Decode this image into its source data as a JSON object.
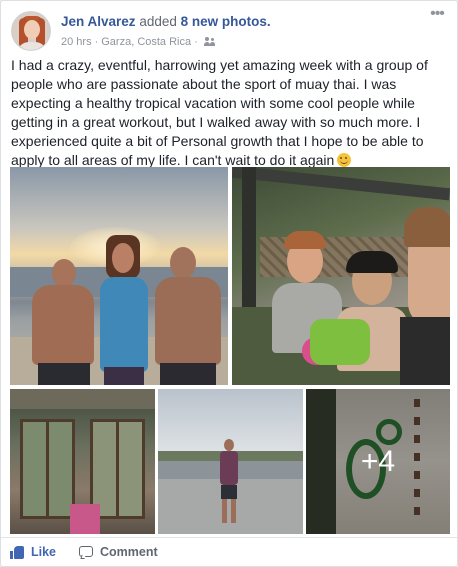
{
  "post": {
    "author": "Jen Alvarez",
    "action_prefix": "added",
    "action_count": "8 new photos.",
    "time": "20 hrs",
    "location": "Garza, Costa Rica",
    "privacy_icon": "friends-icon",
    "more_label": "•••",
    "text": "I had a crazy, eventful, harrowing yet amazing week with a group of people who are passionate about the sport of muay thai. I was expecting a healthy tropical vacation with some cool people while getting in a great workout, but I walked away with so much more. I experienced quite a bit of Personal growth that I hope to be able to apply to all areas of my life. I can't wait to do it again",
    "emoji": "slightly-smiling-face"
  },
  "photos": {
    "more_count": "+4"
  },
  "actions": {
    "like_label": "Like",
    "comment_label": "Comment"
  },
  "colors": {
    "author_link": "#365899",
    "like_blue": "#4267b2",
    "meta_gray": "#90949c"
  }
}
